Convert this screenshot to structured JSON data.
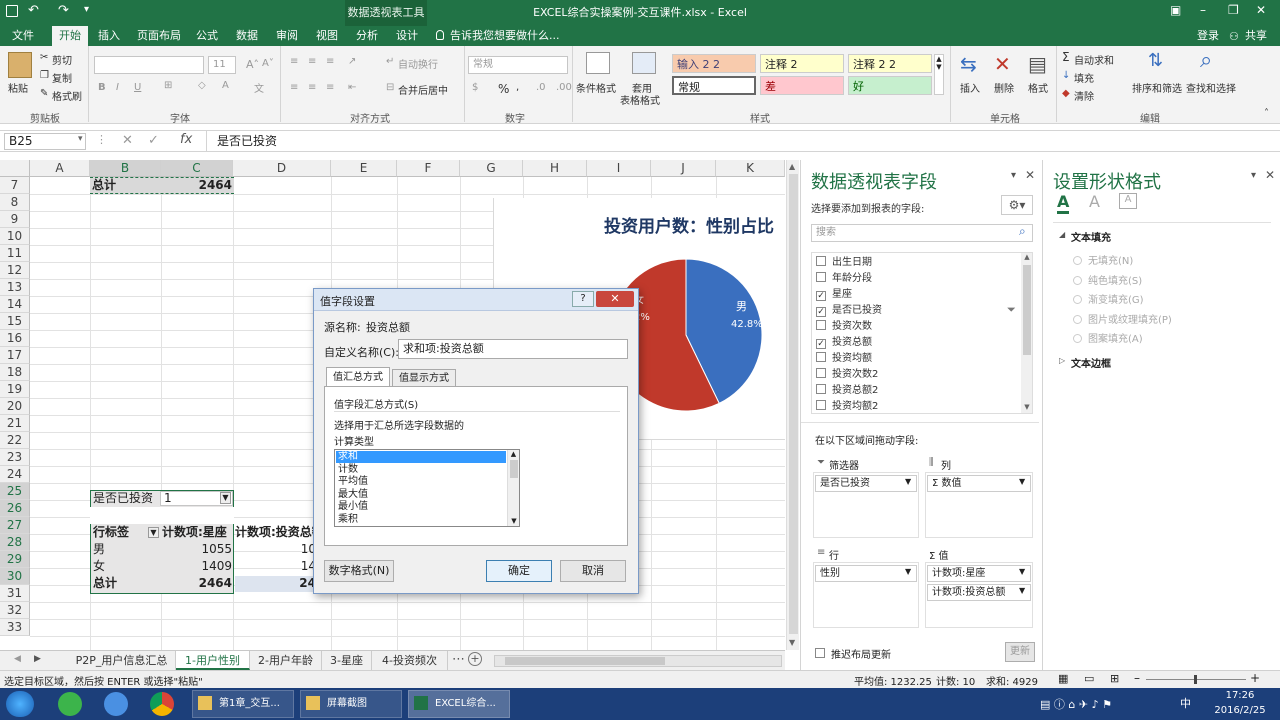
{
  "app": {
    "title": "EXCEL综合实操案例-交互课件.xlsx - Excel",
    "context_tab": "数据透视表工具"
  },
  "menu": {
    "file": "文件",
    "tabs": [
      "开始",
      "插入",
      "页面布局",
      "公式",
      "数据",
      "审阅",
      "视图",
      "分析",
      "设计"
    ],
    "tell_me": "告诉我您想要做什么...",
    "login": "登录",
    "share": "共享"
  },
  "ribbon": {
    "clipboard": {
      "paste": "粘贴",
      "cut": "剪切",
      "copy": "复制",
      "painter": "格式刷",
      "group": "剪贴板"
    },
    "font": {
      "size": "11",
      "group": "字体"
    },
    "align": {
      "wrap": "自动换行",
      "merge": "合并后居中",
      "group": "对齐方式"
    },
    "number": {
      "format": "常规",
      "group": "数字"
    },
    "styles": {
      "cond": "条件格式",
      "table": "套用",
      "table2": "表格格式",
      "group": "样式",
      "cells": [
        "输入 2 2",
        "注释 2",
        "注释 2 2",
        "常规",
        "差",
        "好"
      ]
    },
    "cells": {
      "insert": "插入",
      "delete": "删除",
      "format": "格式",
      "group": "单元格"
    },
    "edit": {
      "autosum": "自动求和",
      "fill": "填充",
      "clear": "清除",
      "sort": "排序和筛选",
      "find": "查找和选择",
      "group": "编辑"
    }
  },
  "formula": {
    "name_box": "B25",
    "value": "是否已投资"
  },
  "columns": [
    "A",
    "B",
    "C",
    "D",
    "E",
    "F",
    "G",
    "H",
    "I",
    "J",
    "K"
  ],
  "rows": [
    "7",
    "8",
    "9",
    "10",
    "11",
    "12",
    "13",
    "14",
    "15",
    "16",
    "17",
    "18",
    "19",
    "20",
    "21",
    "22",
    "23",
    "24",
    "25",
    "26",
    "27",
    "28",
    "29",
    "30",
    "31",
    "32",
    "33"
  ],
  "pivot1": {
    "total_label": "总计",
    "total_value": "2464"
  },
  "pivot2": {
    "filter_label": "是否已投资",
    "filter_value": "1",
    "row_label": "行标签",
    "col1": "计数项:星座",
    "col2": "计数项:投资总额",
    "male": "男",
    "male_v1": "1055",
    "male_v2": "10",
    "female": "女",
    "female_v1": "1409",
    "female_v2": "14",
    "total": "总计",
    "total_v1": "2464",
    "total_v2": "24"
  },
  "chart": {
    "title": "投资用户数：性别占比",
    "male_label": "男",
    "male_pct": "42.8%",
    "female_pct_partial": "2%",
    "female_partial": "女",
    "slices": [
      {
        "name": "男",
        "value": 42.8,
        "color": "#3a6fbf"
      },
      {
        "name": "女",
        "value": 57.2,
        "color": "#c0392b"
      }
    ]
  },
  "dialog": {
    "title": "值字段设置",
    "source_label": "源名称:",
    "source_value": "投资总额",
    "custom_label": "自定义名称(C):",
    "custom_value": "求和项:投资总额",
    "tab1": "值汇总方式",
    "tab2": "值显示方式",
    "section": "值字段汇总方式(S)",
    "desc1": "选择用于汇总所选字段数据的",
    "desc2": "计算类型",
    "list": [
      "求和",
      "计数",
      "平均值",
      "最大值",
      "最小值",
      "乘积"
    ],
    "number_format": "数字格式(N)",
    "ok": "确定",
    "cancel": "取消",
    "help": "?"
  },
  "pivot_fields": {
    "title": "数据透视表字段",
    "subtitle": "选择要添加到报表的字段:",
    "search": "搜索",
    "fields": [
      {
        "name": "出生日期",
        "checked": false
      },
      {
        "name": "年龄分段",
        "checked": false
      },
      {
        "name": "星座",
        "checked": true
      },
      {
        "name": "是否已投资",
        "checked": true
      },
      {
        "name": "投资次数",
        "checked": false
      },
      {
        "name": "投资总额",
        "checked": true
      },
      {
        "name": "投资均额",
        "checked": false
      },
      {
        "name": "投资次数2",
        "checked": false
      },
      {
        "name": "投资总额2",
        "checked": false
      },
      {
        "name": "投资均额2",
        "checked": false
      }
    ],
    "drag_hint": "在以下区域间拖动字段:",
    "filters": "筛选器",
    "filters_item": "是否已投资",
    "cols": "列",
    "cols_item": "Σ 数值",
    "rows_area": "行",
    "rows_item": "性别",
    "values": "Σ 值",
    "values_item1": "计数项:星座",
    "values_item2": "计数项:投资总额",
    "defer": "推迟布局更新",
    "update": "更新"
  },
  "format_pane": {
    "title": "设置形状格式",
    "text_fill": "文本填充",
    "options": [
      "无填充(N)",
      "纯色填充(S)",
      "渐变填充(G)",
      "图片或纹理填充(P)",
      "图案填充(A)"
    ],
    "text_border": "文本边框"
  },
  "sheets": [
    "P2P_用户信息汇总",
    "1-用户性别",
    "2-用户年龄",
    "3-星座",
    "4-投资频次"
  ],
  "status": {
    "left": "选定目标区域，然后按 ENTER 或选择\"粘贴\"",
    "avg": "平均值: 1232.25",
    "count": "计数: 10",
    "sum": "求和: 4929"
  },
  "taskbar": {
    "items": [
      "第1章_交互...",
      "屏幕截图",
      "EXCEL综合..."
    ],
    "time": "17:26",
    "date": "2016/2/25",
    "ime": "中"
  }
}
